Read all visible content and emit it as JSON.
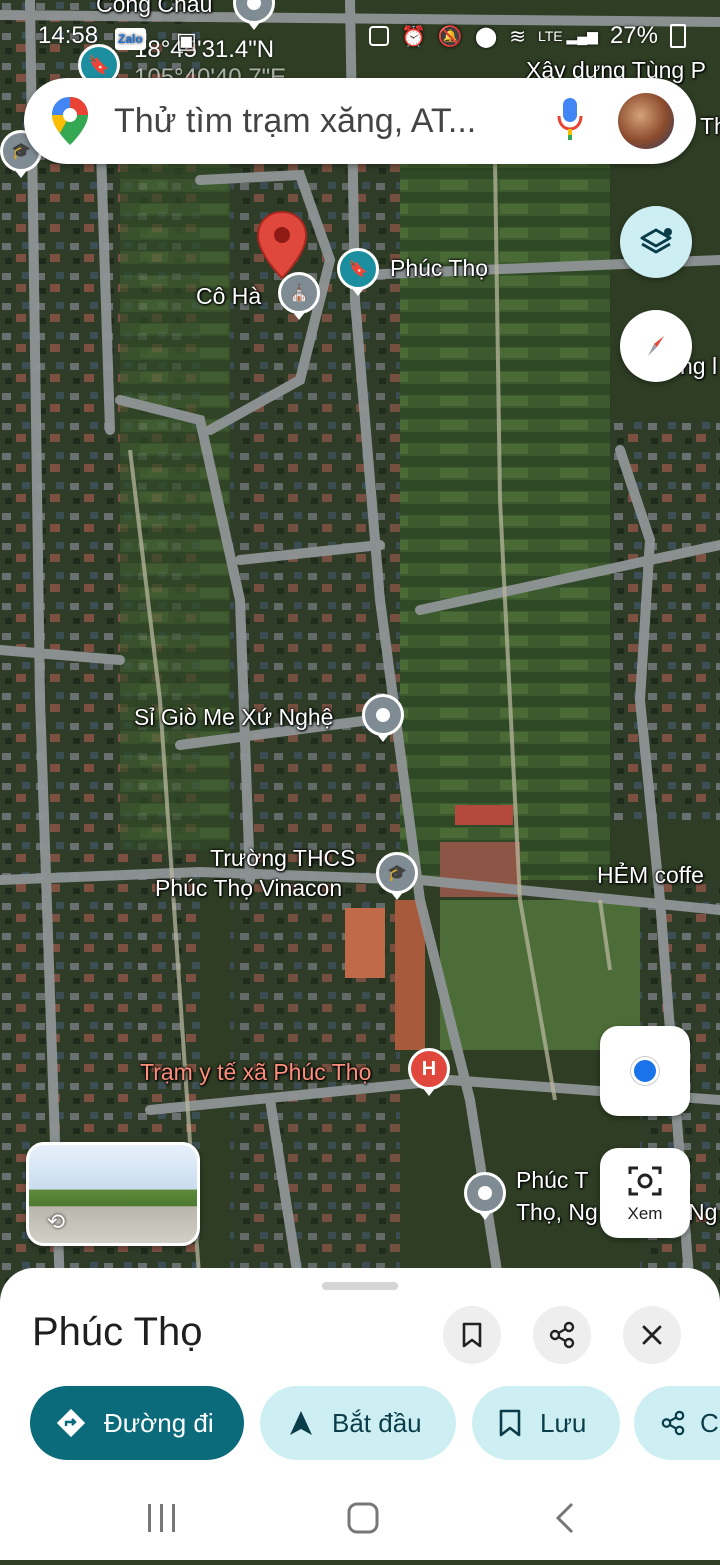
{
  "statusbar": {
    "time": "14:58",
    "coord_line1": "18°45'31.4\"N",
    "coord_line2": "105°40'40.7\"E",
    "battery": "27%",
    "app_badge": "Zalo"
  },
  "search": {
    "placeholder": "Thử tìm trạm xăng, AT..."
  },
  "map_labels": {
    "top_place": "Công Châu",
    "top_right": "Xây dựng Tùng P",
    "right_partial_1": "Th",
    "right_partial_2": "ng l",
    "co_ha": "Cô Hà",
    "phuc_tho_pin": "Phúc Thọ",
    "si_gio": "Sỉ Giò Me Xứ Nghệ",
    "school_l1": "Trường THCS",
    "school_l2": "Phúc Thọ Vinacon",
    "cafe": "HẺM coffe",
    "clinic": "Trạm y tế xã Phúc Thọ",
    "bottom_right_l1": "Phúc T",
    "bottom_right_l2": "Thọ, Ng",
    "bottom_right_extra": "Ng"
  },
  "lens": {
    "label": "Xem"
  },
  "sheet": {
    "title": "Phúc Thọ",
    "actions": {
      "directions": "Đường đi",
      "start": "Bắt đầu",
      "save": "Lưu",
      "share_partial": "C"
    }
  },
  "colors": {
    "accent_teal": "#0b6b7a",
    "chip_light": "#cdeff3",
    "pin_red": "#e0483d",
    "location_blue": "#1a73e8"
  }
}
